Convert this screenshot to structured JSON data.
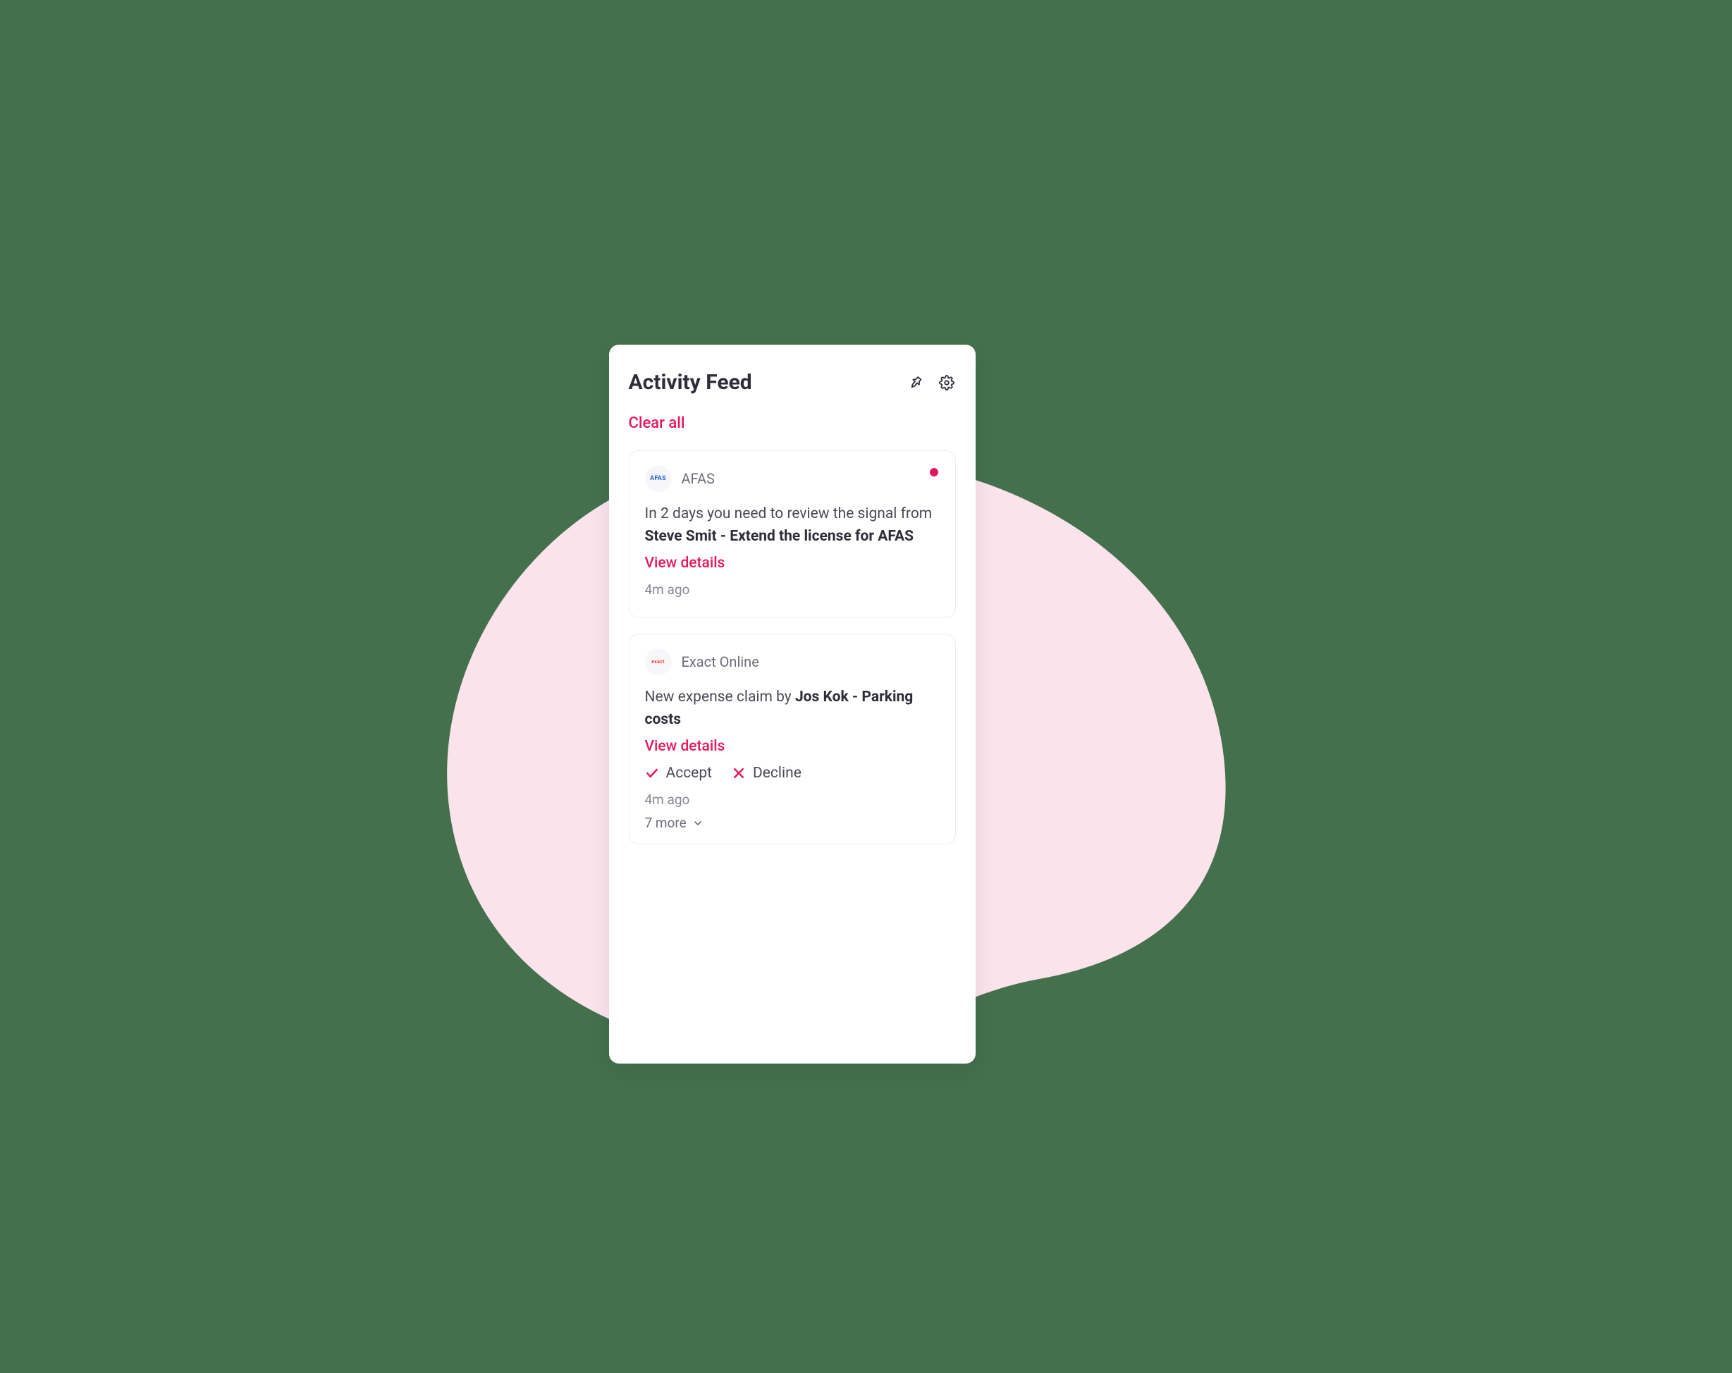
{
  "header": {
    "title": "Activity Feed"
  },
  "clear_all_label": "Clear all",
  "cards": [
    {
      "source": "AFAS",
      "avatar_text": "AFAS",
      "unread": true,
      "body_prefix": "In 2 days you need to review the signal from ",
      "body_bold": "Steve Smit - Extend the license for AFAS",
      "view_details_label": "View details",
      "timestamp": "4m ago"
    },
    {
      "source": "Exact Online",
      "avatar_text": "exact",
      "unread": false,
      "body_prefix": "New expense claim by ",
      "body_bold": "Jos Kok - Parking costs",
      "view_details_label": "View details",
      "accept_label": "Accept",
      "decline_label": "Decline",
      "timestamp": "4m ago",
      "more_label": "7 more"
    }
  ]
}
